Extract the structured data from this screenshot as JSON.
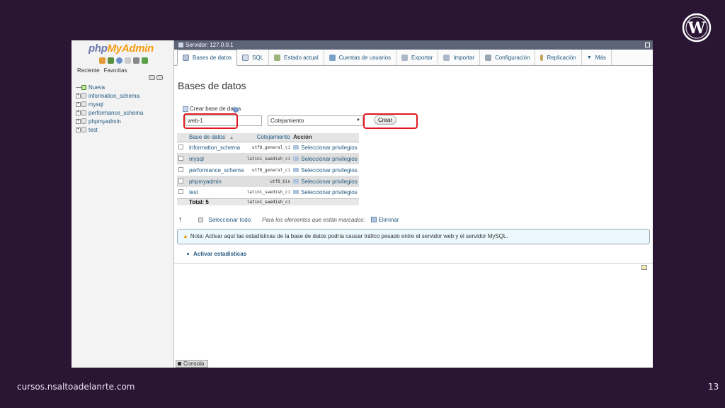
{
  "slide": {
    "footer_url": "cursos.nsaltoadelanrte.com",
    "page_number": "13"
  },
  "navigation": {
    "logo_php": "php",
    "logo_myadmin": "MyAdmin",
    "tabs": [
      "Reciente",
      "Favoritas"
    ],
    "new_label": "Nueva",
    "databases": [
      "information_schema",
      "mysql",
      "performance_schema",
      "phpmyadmin",
      "test"
    ]
  },
  "server_bar": {
    "title": "Servidor: 127.0.0.1"
  },
  "top_menu": {
    "tabs": [
      {
        "label": "Bases de datos",
        "icon": "database-icon",
        "active": true
      },
      {
        "label": "SQL",
        "icon": "sql-icon"
      },
      {
        "label": "Estado actual",
        "icon": "status-icon"
      },
      {
        "label": "Cuentas de usuarios",
        "icon": "users-icon"
      },
      {
        "label": "Exportar",
        "icon": "export-icon"
      },
      {
        "label": "Importar",
        "icon": "import-icon"
      },
      {
        "label": "Configuración",
        "icon": "settings-icon"
      },
      {
        "label": "Replicación",
        "icon": "replication-icon"
      },
      {
        "label": "Más",
        "icon": "chevron-down-icon"
      }
    ]
  },
  "main": {
    "title": "Bases de datos",
    "create": {
      "legend": "Crear base de datos",
      "db_name_value": "web-1",
      "collation_value": "Cotejamiento",
      "button_label": "Crear"
    },
    "table": {
      "headers": [
        "Base de datos",
        "Cotejamiento",
        "Acción"
      ],
      "rows": [
        {
          "name": "information_schema",
          "collation": "utf8_general_ci",
          "action": "Seleccionar privilegios"
        },
        {
          "name": "mysql",
          "collation": "latin1_swedish_ci",
          "action": "Seleccionar privilegios"
        },
        {
          "name": "performance_schema",
          "collation": "utf8_general_ci",
          "action": "Seleccionar privilegios"
        },
        {
          "name": "phpmyadmin",
          "collation": "utf8_bin",
          "action": "Seleccionar privilegios"
        },
        {
          "name": "test",
          "collation": "latin1_swedish_ci",
          "action": "Seleccionar privilegios"
        }
      ],
      "total_label": "Total: 5",
      "total_collation": "latin1_swedish_ci"
    },
    "bulk": {
      "select_all": "Seleccionar todo",
      "for_selected": "Para los elementos que están marcados:",
      "delete": "Eliminar"
    },
    "notice": "Nota: Activar aquí las estadísticas de la base de datos podría causar tráfico pesado entre el servidor web y el servidor MySQL.",
    "enable_stats": "Activar estadísticas"
  },
  "console": {
    "label": "Consola"
  },
  "colors": {
    "slide_bg": "#2a1535",
    "link": "#235a81",
    "highlight": "#e0161e",
    "server_bar": "#5d6478"
  }
}
